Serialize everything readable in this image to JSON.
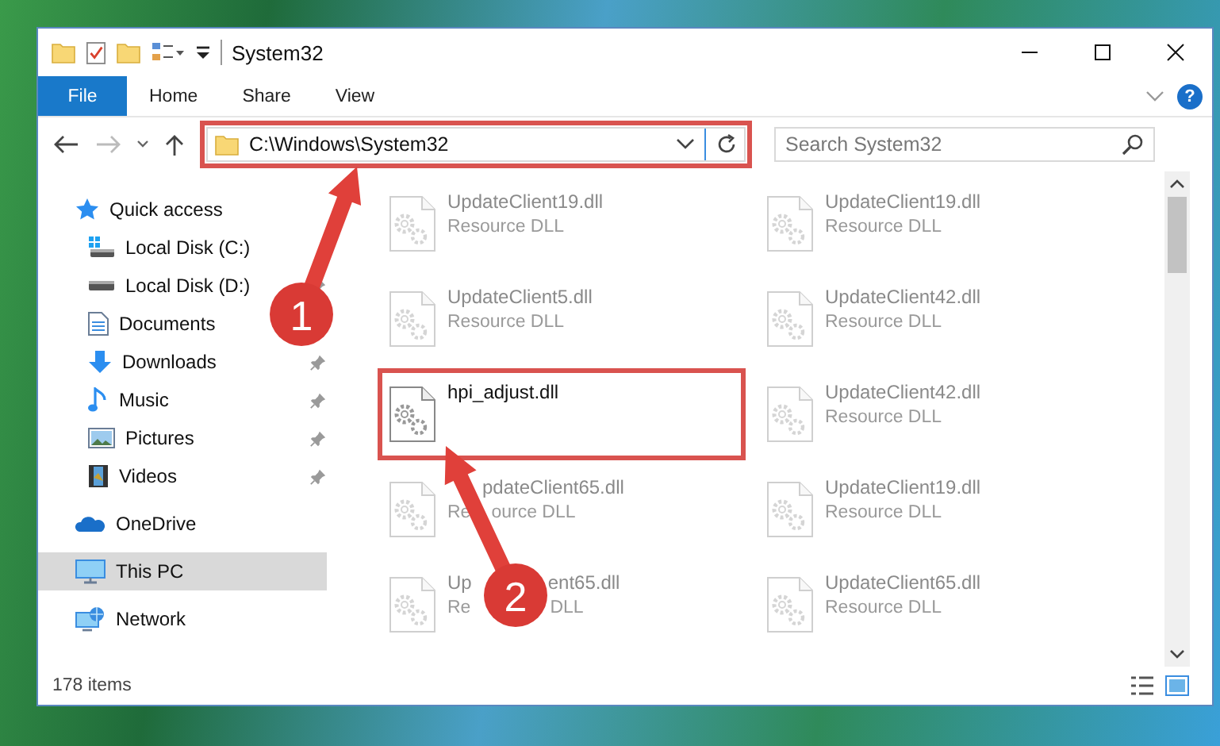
{
  "window": {
    "title": "System32"
  },
  "ribbon": {
    "tabs": [
      {
        "label": "File",
        "selected": true
      },
      {
        "label": "Home",
        "selected": false
      },
      {
        "label": "Share",
        "selected": false
      },
      {
        "label": "View",
        "selected": false
      }
    ],
    "help": "?"
  },
  "address": {
    "path": "C:\\Windows\\System32",
    "highlighted": true
  },
  "search": {
    "placeholder": "Search System32"
  },
  "sidebar": {
    "items": [
      {
        "label": "Quick access",
        "kind": "star",
        "selected": false,
        "children": [
          {
            "label": "Local Disk (C:)",
            "kind": "system-drive",
            "selected": false
          },
          {
            "label": "Local Disk (D:)",
            "kind": "drive",
            "pinned": true,
            "selected": false
          },
          {
            "label": "Documents",
            "kind": "document",
            "selected": false
          },
          {
            "label": "Downloads",
            "kind": "download",
            "pinned": true,
            "selected": false
          },
          {
            "label": "Music",
            "kind": "music",
            "pinned": true,
            "selected": false
          },
          {
            "label": "Pictures",
            "kind": "picture",
            "pinned": true,
            "selected": false
          },
          {
            "label": "Videos",
            "kind": "video",
            "pinned": true,
            "selected": false
          }
        ]
      },
      {
        "label": "OneDrive",
        "kind": "cloud",
        "selected": false
      },
      {
        "label": "This PC",
        "kind": "computer",
        "selected": true
      },
      {
        "label": "Network",
        "kind": "network",
        "selected": false
      }
    ]
  },
  "files": [
    {
      "name": "UpdateClient19.dll",
      "type": "Resource DLL",
      "kind": "plain",
      "faded": true,
      "highlighted": false
    },
    {
      "name": "UpdateClient19.dll",
      "type": "Resource DLL",
      "kind": "plain",
      "faded": true,
      "highlighted": false
    },
    {
      "name": "UpdateClient5.dll",
      "type": "Resource DLL",
      "kind": "plain",
      "faded": true,
      "highlighted": false
    },
    {
      "name": "UpdateClient42.dll",
      "type": "Resource DLL",
      "kind": "plain",
      "faded": true,
      "highlighted": false
    },
    {
      "name": "hpi_adjust.dll",
      "kind": "plain",
      "faded": false,
      "highlighted": true
    },
    {
      "name": "UpdateClient42.dll",
      "type": "Resource DLL",
      "kind": "plain",
      "faded": true,
      "highlighted": false
    },
    {
      "name": "pdateClient65.dll",
      "type": [
        "Re",
        "ource DLL"
      ],
      "kind": "under-arrow",
      "faded": true,
      "highlighted": false
    },
    {
      "name": "UpdateClient19.dll",
      "type": "Resource DLL",
      "kind": "plain",
      "faded": true,
      "highlighted": false
    },
    {
      "name": [
        "Up",
        "ent65.dll"
      ],
      "type": [
        "Re",
        "DLL"
      ],
      "kind": "under-callout",
      "faded": true,
      "highlighted": false
    },
    {
      "name": "UpdateClient65.dll",
      "type": "Resource DLL",
      "kind": "plain",
      "faded": true,
      "highlighted": false
    }
  ],
  "status_bar": {
    "count": "178 items"
  },
  "callouts": [
    {
      "number": "1"
    },
    {
      "number": "2"
    }
  ]
}
